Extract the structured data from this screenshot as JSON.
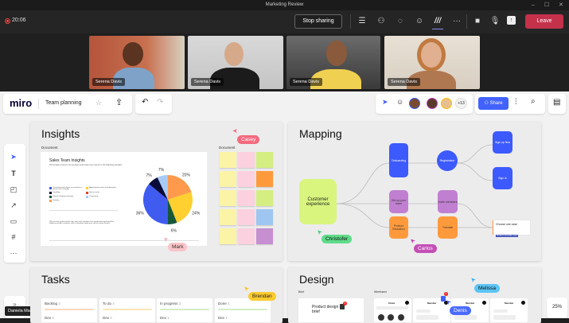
{
  "window": {
    "title": "Marketing Review",
    "minimize": "–",
    "maximize": "☐",
    "close": "✕"
  },
  "call": {
    "timer": "20:06",
    "stop_sharing": "Stop sharing",
    "leave": "Leave",
    "icons": [
      "list-icon",
      "people-icon",
      "chat-icon",
      "react-icon",
      "miro-app-icon",
      "more-icon",
      "camera-icon",
      "mic-icon",
      "share-tray-icon"
    ],
    "more": "···"
  },
  "participants": [
    {
      "name": "Serena Davis"
    },
    {
      "name": "Serena Davis"
    },
    {
      "name": "Serena Davis"
    },
    {
      "name": "Serena Davis"
    }
  ],
  "miro": {
    "logo": "miro",
    "board_name": "Team planning",
    "share": "Share",
    "extra_collaborators": "+13",
    "zoom": "25%",
    "collapse": "»",
    "user_tooltip": "Daniela Mandera"
  },
  "insights": {
    "title": "Insights",
    "doc_label": "Document",
    "sticky_label": "Document",
    "doc_title": "Sales Team Insights",
    "doc_subtitle": "Percentage of time in an average week sales reps spend on the following activities",
    "legend": [
      "Connecting with clients or prospects in person (incl. virtually)",
      "Administrative tasks and alignment",
      "Travelling",
      "Service tasks",
      "Internal company meetings",
      "Commuting",
      "Training"
    ],
    "footnote": "49% of sales professionals say using sales analytics has significantly improved their ability to provide customers with a consistent experience across every channel."
  },
  "chart_data": {
    "type": "pie",
    "title": "Sales Team Insights",
    "slices": [
      {
        "label": "Administrative tasks and alignment (orange)",
        "value": 20,
        "color": "#ff9a4d"
      },
      {
        "label": "Connecting with clients (yellow)",
        "value": 24,
        "color": "#ffd02f"
      },
      {
        "label": "Internal company meetings",
        "value": 6,
        "color": "#17573a"
      },
      {
        "label": "Connecting with clients or prospects",
        "value": 36,
        "color": "#3f5bf0"
      },
      {
        "label": "Travelling",
        "value": 7,
        "color": "#0b0b3a"
      },
      {
        "label": "Commuting",
        "value": 7,
        "color": "#a8cbf5"
      }
    ],
    "data_labels": [
      "20%",
      "24%",
      "6%",
      "36%",
      "7%",
      "7%"
    ]
  },
  "mapping": {
    "title": "Mapping",
    "nodes": {
      "customer": "Customer experience",
      "onboarding": "Onboarding",
      "registration": "Registration",
      "signup": "Sign up flow",
      "signin": "Sign in",
      "setup": "Set up your team",
      "invite": "Invite members",
      "product": "Product Education",
      "tutorials": "Tutorials",
      "choose": "Choose use case",
      "choose_value": "Product education team"
    }
  },
  "cursors": {
    "casey": "Casey",
    "mark": "Mark",
    "christofer": "Christofer",
    "carlos": "Carlos",
    "brendan": "Brendan",
    "melissa": "Melissa",
    "denis": "Denis"
  },
  "tasks": {
    "title": "Tasks",
    "columns": [
      {
        "name": "Backlog",
        "count": "3",
        "item": "Dev",
        "item_count": "3",
        "color": "#fbd9c0"
      },
      {
        "name": "To do",
        "count": "4",
        "item": "Dev",
        "item_count": "3",
        "color": "#fbe6b8"
      },
      {
        "name": "In progress",
        "count": "3",
        "item": "Dev",
        "item_count": "1",
        "color": "#d5ecc7"
      },
      {
        "name": "Done",
        "count": "3",
        "item": "Dev",
        "item_count": "1",
        "color": "#d5ecc7"
      }
    ]
  },
  "design": {
    "title": "Design",
    "brief_label": "Brief",
    "wireframe_label": "Wireframe",
    "brief_title": "Product design brief",
    "badge": "1",
    "wf_header": [
      "Chats",
      "Member",
      "Member",
      "Member"
    ]
  }
}
